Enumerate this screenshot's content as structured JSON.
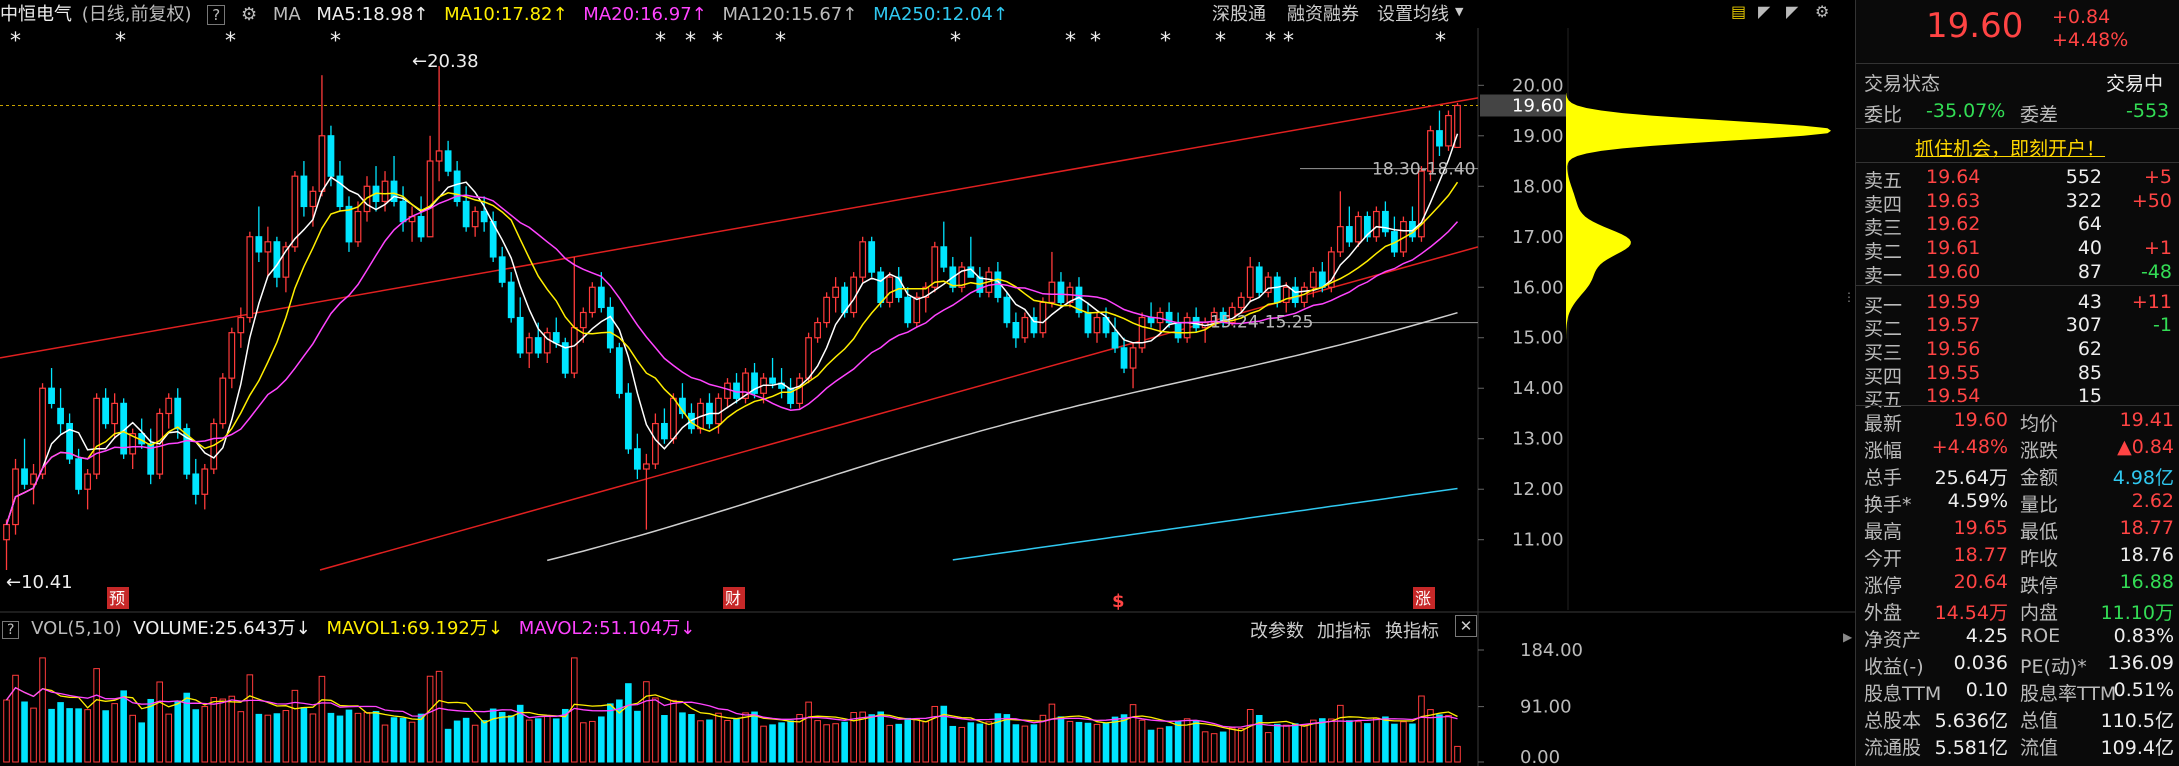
{
  "header": {
    "stock_name": "中恒电气",
    "mode": "(日线,前复权)",
    "help": "?",
    "ma_label": "MA",
    "ma5": "MA5:18.98",
    "ma10": "MA10:17.82",
    "ma20": "MA20:16.97",
    "ma120": "MA120:15.67",
    "ma250": "MA250:12.04",
    "shengutong": "深股通",
    "rongzi": "融资融券",
    "settings": "设置均线"
  },
  "colors": {
    "up": "#ff3b3b",
    "down": "#00e5ff",
    "ma5": "#ffffff",
    "ma10": "#ffee00",
    "ma20": "#ff44ff",
    "ma120": "#cfcfcf",
    "ma250": "#30c8f0",
    "channel": "#e02020",
    "profile": "#ffff00"
  },
  "chart_data": [
    {
      "type": "candlestick",
      "title": "中恒电气 (日线,前复权)",
      "ylim": [
        10.4,
        20.6
      ],
      "y_ticks": [
        "20.00",
        "19.00",
        "18.00",
        "17.00",
        "16.00",
        "15.00",
        "14.00",
        "13.00",
        "12.00",
        "11.00"
      ],
      "current_price": "19.60",
      "annotations": {
        "high": "20.38",
        "low": "10.41",
        "resistance": "18.30-18.40",
        "support": "15.24-15.25"
      },
      "markers": [
        "预",
        "财",
        "$",
        "涨"
      ],
      "candles": [
        [
          11.0,
          11.4,
          10.4,
          11.3
        ],
        [
          11.3,
          12.6,
          11.1,
          12.4
        ],
        [
          12.4,
          13.0,
          12.0,
          12.1
        ],
        [
          12.1,
          12.5,
          11.7,
          12.3
        ],
        [
          12.3,
          14.1,
          12.2,
          14.0
        ],
        [
          14.0,
          14.4,
          13.6,
          13.7
        ],
        [
          13.6,
          14.0,
          13.1,
          13.3
        ],
        [
          13.3,
          13.5,
          12.5,
          12.6
        ],
        [
          12.6,
          12.8,
          11.9,
          12.0
        ],
        [
          12.0,
          12.4,
          11.6,
          12.3
        ],
        [
          12.3,
          13.9,
          12.2,
          13.8
        ],
        [
          13.8,
          14.0,
          13.2,
          13.3
        ],
        [
          13.3,
          13.9,
          13.0,
          13.7
        ],
        [
          13.7,
          13.8,
          12.6,
          12.7
        ],
        [
          12.7,
          13.2,
          12.4,
          13.1
        ],
        [
          13.1,
          13.4,
          12.8,
          12.9
        ],
        [
          12.9,
          13.2,
          12.1,
          12.3
        ],
        [
          12.3,
          13.6,
          12.2,
          13.5
        ],
        [
          13.5,
          13.9,
          13.2,
          13.8
        ],
        [
          13.8,
          14.0,
          13.0,
          13.2
        ],
        [
          13.2,
          13.3,
          12.2,
          12.3
        ],
        [
          12.3,
          12.6,
          11.7,
          11.9
        ],
        [
          11.9,
          12.5,
          11.6,
          12.4
        ],
        [
          12.4,
          13.4,
          12.3,
          13.3
        ],
        [
          13.3,
          14.3,
          13.2,
          14.2
        ],
        [
          14.2,
          15.2,
          14.0,
          15.1
        ],
        [
          15.1,
          15.6,
          14.8,
          15.4
        ],
        [
          15.4,
          17.1,
          15.3,
          17.0
        ],
        [
          17.0,
          17.6,
          16.5,
          16.7
        ],
        [
          16.7,
          17.2,
          16.2,
          16.9
        ],
        [
          16.9,
          17.0,
          16.0,
          16.2
        ],
        [
          16.2,
          16.9,
          15.9,
          16.8
        ],
        [
          16.8,
          18.3,
          16.7,
          18.2
        ],
        [
          18.2,
          18.5,
          17.4,
          17.6
        ],
        [
          17.6,
          18.0,
          17.2,
          17.9
        ],
        [
          17.9,
          20.2,
          17.8,
          19.0
        ],
        [
          19.0,
          19.2,
          18.0,
          18.2
        ],
        [
          18.2,
          18.5,
          17.5,
          17.6
        ],
        [
          17.6,
          17.8,
          16.7,
          16.9
        ],
        [
          16.9,
          17.7,
          16.8,
          17.5
        ],
        [
          17.5,
          18.2,
          17.3,
          18.0
        ],
        [
          18.0,
          18.4,
          17.5,
          17.7
        ],
        [
          17.7,
          18.3,
          17.5,
          18.1
        ],
        [
          18.1,
          18.6,
          17.6,
          17.7
        ],
        [
          17.7,
          18.0,
          17.1,
          17.3
        ],
        [
          17.3,
          17.6,
          16.9,
          17.4
        ],
        [
          17.4,
          17.8,
          16.9,
          17.0
        ],
        [
          17.0,
          19.0,
          17.0,
          18.5
        ],
        [
          18.5,
          20.38,
          18.1,
          18.7
        ],
        [
          18.7,
          18.9,
          18.2,
          18.3
        ],
        [
          18.3,
          18.5,
          17.6,
          17.7
        ],
        [
          17.7,
          18.0,
          17.1,
          17.2
        ],
        [
          17.2,
          17.6,
          17.0,
          17.5
        ],
        [
          17.5,
          17.8,
          17.1,
          17.3
        ],
        [
          17.3,
          17.5,
          16.5,
          16.6
        ],
        [
          16.6,
          16.8,
          16.0,
          16.1
        ],
        [
          16.1,
          16.3,
          15.3,
          15.4
        ],
        [
          15.4,
          15.8,
          14.6,
          14.7
        ],
        [
          14.7,
          15.1,
          14.4,
          15.0
        ],
        [
          15.0,
          15.3,
          14.6,
          14.7
        ],
        [
          14.7,
          15.2,
          14.5,
          15.1
        ],
        [
          15.1,
          15.4,
          14.8,
          14.9
        ],
        [
          14.9,
          15.0,
          14.2,
          14.3
        ],
        [
          14.3,
          16.6,
          14.2,
          15.2
        ],
        [
          15.2,
          15.6,
          14.9,
          15.5
        ],
        [
          15.5,
          16.1,
          15.4,
          16.0
        ],
        [
          16.0,
          16.3,
          15.5,
          15.6
        ],
        [
          15.6,
          15.8,
          14.7,
          14.8
        ],
        [
          14.8,
          14.9,
          13.8,
          13.9
        ],
        [
          13.9,
          14.1,
          12.7,
          12.8
        ],
        [
          12.8,
          13.1,
          12.2,
          12.4
        ],
        [
          12.4,
          12.7,
          11.2,
          12.5
        ],
        [
          12.5,
          13.5,
          12.4,
          13.3
        ],
        [
          13.3,
          13.6,
          12.9,
          13.0
        ],
        [
          13.0,
          13.9,
          12.9,
          13.8
        ],
        [
          13.8,
          14.1,
          13.4,
          13.5
        ],
        [
          13.5,
          13.7,
          13.1,
          13.2
        ],
        [
          13.2,
          13.8,
          13.1,
          13.7
        ],
        [
          13.7,
          13.9,
          13.2,
          13.3
        ],
        [
          13.3,
          13.9,
          13.1,
          13.8
        ],
        [
          13.8,
          14.2,
          13.6,
          14.1
        ],
        [
          14.1,
          14.3,
          13.7,
          13.8
        ],
        [
          13.8,
          14.4,
          13.7,
          14.3
        ],
        [
          14.3,
          14.5,
          13.8,
          13.9
        ],
        [
          13.9,
          14.3,
          13.7,
          14.2
        ],
        [
          14.2,
          14.6,
          14.0,
          14.1
        ],
        [
          14.1,
          14.4,
          13.8,
          14.0
        ],
        [
          14.0,
          14.2,
          13.6,
          13.7
        ],
        [
          13.7,
          14.3,
          13.6,
          14.2
        ],
        [
          14.2,
          15.1,
          14.1,
          15.0
        ],
        [
          15.0,
          15.4,
          14.9,
          15.3
        ],
        [
          15.3,
          15.9,
          15.2,
          15.8
        ],
        [
          15.8,
          16.2,
          15.5,
          16.0
        ],
        [
          16.0,
          16.1,
          15.4,
          15.5
        ],
        [
          15.5,
          16.3,
          15.4,
          16.2
        ],
        [
          16.2,
          17.0,
          16.1,
          16.9
        ],
        [
          16.9,
          17.0,
          16.2,
          16.3
        ],
        [
          16.3,
          16.4,
          15.6,
          15.7
        ],
        [
          15.7,
          16.3,
          15.6,
          16.2
        ],
        [
          16.2,
          16.4,
          15.7,
          15.8
        ],
        [
          15.8,
          16.0,
          15.2,
          15.3
        ],
        [
          15.3,
          15.9,
          15.2,
          15.8
        ],
        [
          15.8,
          16.1,
          15.5,
          16.0
        ],
        [
          16.0,
          16.9,
          15.9,
          16.8
        ],
        [
          16.8,
          17.3,
          16.3,
          16.4
        ],
        [
          16.4,
          16.6,
          15.9,
          16.0
        ],
        [
          16.0,
          16.5,
          15.9,
          16.4
        ],
        [
          16.4,
          17.0,
          16.3,
          16.2
        ],
        [
          16.2,
          16.4,
          15.8,
          15.9
        ],
        [
          15.9,
          16.4,
          15.8,
          16.3
        ],
        [
          16.3,
          16.5,
          15.7,
          15.8
        ],
        [
          15.8,
          15.9,
          15.2,
          15.3
        ],
        [
          15.3,
          15.5,
          14.8,
          15.0
        ],
        [
          15.0,
          15.5,
          14.9,
          15.4
        ],
        [
          15.4,
          15.6,
          15.0,
          15.1
        ],
        [
          15.1,
          15.8,
          15.0,
          15.7
        ],
        [
          15.7,
          16.7,
          15.6,
          16.1
        ],
        [
          16.1,
          16.3,
          15.6,
          15.7
        ],
        [
          15.7,
          16.1,
          15.6,
          16.0
        ],
        [
          16.0,
          16.2,
          15.4,
          15.5
        ],
        [
          15.5,
          15.7,
          15.0,
          15.1
        ],
        [
          15.1,
          15.5,
          14.9,
          15.4
        ],
        [
          15.4,
          15.6,
          15.0,
          15.1
        ],
        [
          15.1,
          15.4,
          14.7,
          14.8
        ],
        [
          14.8,
          15.0,
          14.3,
          14.4
        ],
        [
          14.4,
          14.9,
          14.0,
          14.8
        ],
        [
          14.8,
          15.5,
          14.7,
          15.4
        ],
        [
          15.4,
          15.7,
          15.2,
          15.3
        ],
        [
          15.3,
          15.6,
          15.1,
          15.5
        ],
        [
          15.5,
          15.7,
          15.2,
          15.3
        ],
        [
          15.3,
          15.5,
          14.9,
          15.0
        ],
        [
          15.0,
          15.5,
          14.9,
          15.4
        ],
        [
          15.4,
          15.6,
          15.1,
          15.2
        ],
        [
          15.2,
          15.4,
          14.9,
          15.3
        ],
        [
          15.3,
          15.6,
          15.2,
          15.5
        ],
        [
          15.5,
          15.6,
          15.2,
          15.3
        ],
        [
          15.3,
          15.7,
          15.24,
          15.6
        ],
        [
          15.6,
          15.9,
          15.5,
          15.8
        ],
        [
          15.8,
          16.6,
          15.7,
          16.4
        ],
        [
          16.4,
          16.5,
          15.8,
          15.9
        ],
        [
          15.9,
          16.3,
          15.8,
          16.2
        ],
        [
          16.2,
          16.3,
          15.6,
          15.7
        ],
        [
          15.7,
          16.1,
          15.5,
          16.0
        ],
        [
          16.0,
          16.2,
          15.6,
          15.7
        ],
        [
          15.7,
          16.1,
          15.6,
          16.0
        ],
        [
          16.0,
          16.4,
          15.8,
          16.3
        ],
        [
          16.3,
          16.5,
          15.9,
          16.0
        ],
        [
          16.0,
          16.8,
          15.9,
          16.7
        ],
        [
          16.7,
          17.9,
          16.6,
          17.2
        ],
        [
          17.2,
          17.6,
          16.8,
          16.9
        ],
        [
          16.9,
          17.5,
          16.8,
          17.4
        ],
        [
          17.4,
          17.5,
          16.9,
          17.0
        ],
        [
          17.0,
          17.6,
          16.9,
          17.5
        ],
        [
          17.5,
          17.7,
          17.0,
          17.1
        ],
        [
          17.1,
          17.4,
          16.6,
          16.7
        ],
        [
          16.7,
          17.4,
          16.6,
          17.3
        ],
        [
          17.3,
          17.6,
          16.9,
          17.0
        ],
        [
          17.0,
          18.4,
          16.9,
          18.3
        ],
        [
          18.3,
          19.2,
          18.1,
          19.1
        ],
        [
          19.1,
          19.5,
          18.6,
          18.8
        ],
        [
          18.8,
          19.5,
          18.7,
          19.4
        ],
        [
          18.77,
          19.65,
          18.77,
          19.6
        ]
      ],
      "volume_header": {
        "vol": "VOL(5,10)",
        "volume": "VOLUME:25.643万",
        "mavol1": "MAVOL1:69.192万",
        "mavol2": "MAVOL2:51.104万"
      },
      "volume_ylim": [
        0,
        184
      ],
      "volume_ticks": [
        "184.00",
        "91.00",
        "0.00"
      ],
      "volume_buttons": [
        "改参数",
        "加指标",
        "换指标"
      ]
    }
  ],
  "quote": {
    "price": "19.60",
    "change": "+0.84",
    "change_pct": "+4.48%",
    "status_label": "交易状态",
    "status_value": "交易中",
    "weibi_label": "委比",
    "weibi_value": "-35.07%",
    "weicha_label": "委差",
    "weicha_value": "-553",
    "promo": "抓住机会，即刻开户！",
    "asks": [
      {
        "label": "卖五",
        "price": "19.64",
        "vol": "552",
        "chg": "+5"
      },
      {
        "label": "卖四",
        "price": "19.63",
        "vol": "322",
        "chg": "+50"
      },
      {
        "label": "卖三",
        "price": "19.62",
        "vol": "64",
        "chg": ""
      },
      {
        "label": "卖二",
        "price": "19.61",
        "vol": "40",
        "chg": "+1"
      },
      {
        "label": "卖一",
        "price": "19.60",
        "vol": "87",
        "chg": "-48"
      }
    ],
    "bids": [
      {
        "label": "买一",
        "price": "19.59",
        "vol": "43",
        "chg": "+11"
      },
      {
        "label": "买二",
        "price": "19.57",
        "vol": "307",
        "chg": "-1"
      },
      {
        "label": "买三",
        "price": "19.56",
        "vol": "62",
        "chg": ""
      },
      {
        "label": "买四",
        "price": "19.55",
        "vol": "85",
        "chg": ""
      },
      {
        "label": "买五",
        "price": "19.54",
        "vol": "15",
        "chg": ""
      }
    ],
    "stats": [
      {
        "l1": "最新",
        "v1": "19.60",
        "c1": "red",
        "l2": "均价",
        "v2": "19.41",
        "c2": "red"
      },
      {
        "l1": "涨幅",
        "v1": "+4.48%",
        "c1": "red",
        "l2": "涨跌",
        "v2": "▲0.84",
        "c2": "red"
      },
      {
        "l1": "总手",
        "v1": "25.64万",
        "c1": "white",
        "l2": "金额",
        "v2": "4.98亿",
        "c2": "cyan"
      },
      {
        "l1": "换手*",
        "v1": "4.59%",
        "c1": "white",
        "l2": "量比",
        "v2": "2.62",
        "c2": "red"
      },
      {
        "l1": "最高",
        "v1": "19.65",
        "c1": "red",
        "l2": "最低",
        "v2": "18.77",
        "c2": "red"
      },
      {
        "l1": "今开",
        "v1": "18.77",
        "c1": "red",
        "l2": "昨收",
        "v2": "18.76",
        "c2": "white"
      },
      {
        "l1": "涨停",
        "v1": "20.64",
        "c1": "red",
        "l2": "跌停",
        "v2": "16.88",
        "c2": "green"
      },
      {
        "l1": "外盘",
        "v1": "14.54万",
        "c1": "red",
        "l2": "内盘",
        "v2": "11.10万",
        "c2": "green"
      },
      {
        "l1": "净资产",
        "v1": "4.25",
        "c1": "white",
        "l2": "ROE",
        "v2": "0.83%",
        "c2": "white"
      },
      {
        "l1": "收益(-)",
        "v1": "0.036",
        "c1": "white",
        "l2": "PE(动)*",
        "v2": "136.09",
        "c2": "white"
      },
      {
        "l1": "股息TTM",
        "v1": "0.10",
        "c1": "white",
        "l2": "股息率TTM",
        "v2": "0.51%",
        "c2": "white"
      },
      {
        "l1": "总股本",
        "v1": "5.636亿",
        "c1": "white",
        "l2": "总值",
        "v2": "110.5亿",
        "c2": "white"
      },
      {
        "l1": "流通股",
        "v1": "5.581亿",
        "c1": "white",
        "l2": "流值",
        "v2": "109.4亿",
        "c2": "white"
      }
    ]
  }
}
